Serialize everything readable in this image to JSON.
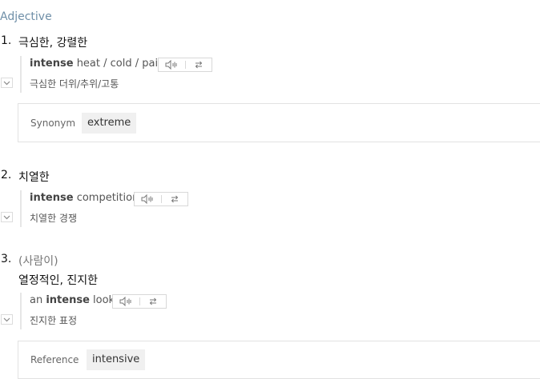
{
  "part_of_speech": "Adjective",
  "senses": [
    {
      "number": "1.",
      "meaning": "극심한, 강렬한",
      "example": {
        "pre": "",
        "bold": "intense",
        "post": " heat / cold / pain",
        "translation": "극심한 더위/추위/고통"
      },
      "relation": {
        "label": "Synonym",
        "value": "extreme"
      }
    },
    {
      "number": "2.",
      "meaning": "치열한",
      "example": {
        "pre": "",
        "bold": "intense",
        "post": " competition",
        "translation": "치열한 경쟁"
      }
    },
    {
      "number": "3.",
      "qualifier": "(사람이)",
      "meaning": "열정적인, 진지한",
      "example": {
        "pre": "an ",
        "bold": "intense",
        "post": " look",
        "translation": "진지한 표정"
      },
      "relation": {
        "label": "Reference",
        "value": "intensive"
      }
    }
  ],
  "icons": {
    "listen": "speaker-icon",
    "repeat": "repeat-icon",
    "expand": "chevron-down-icon"
  },
  "colors": {
    "pos_label": "#6f8fa8",
    "chip_bg": "#f0f0f0",
    "border": "#e2e2e2"
  }
}
